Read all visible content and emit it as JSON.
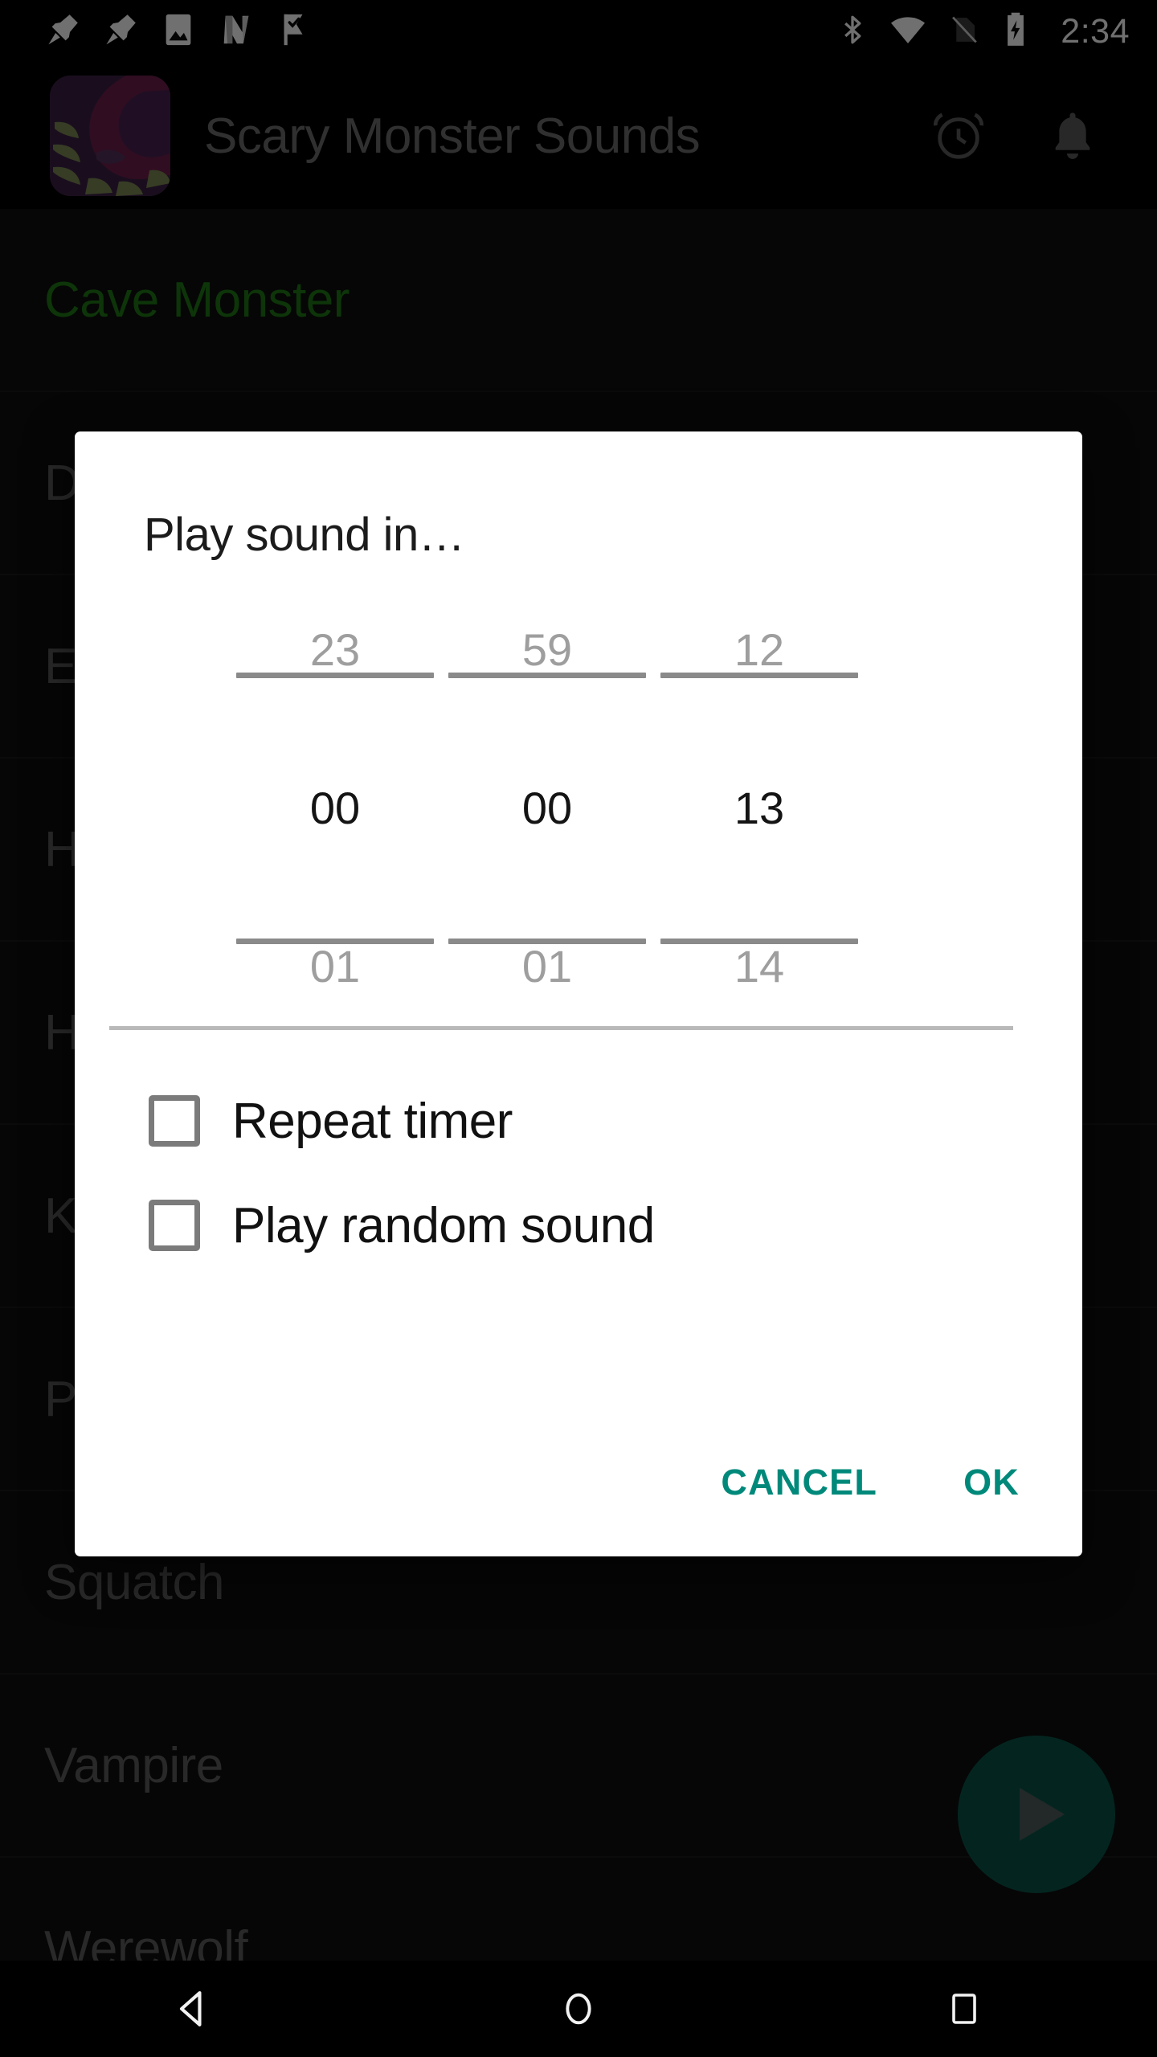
{
  "status_bar": {
    "notification_icons": [
      "pin-icon",
      "pin-icon",
      "image-icon",
      "n-app-icon",
      "checkmark-flag-icon"
    ],
    "system_icons": [
      "bluetooth-icon",
      "wifi-icon",
      "no-sim-icon",
      "battery-charging-icon"
    ],
    "clock": "2:34"
  },
  "app_bar": {
    "title": "Scary Monster Sounds",
    "icon_name": "app-logo-monster",
    "actions": [
      {
        "name": "alarm-clock-icon",
        "label": "Timer"
      },
      {
        "name": "bell-icon",
        "label": "Notification"
      }
    ]
  },
  "sound_list": {
    "items": [
      {
        "label": "Cave Monster",
        "selected": true
      },
      {
        "label": "D",
        "selected": false
      },
      {
        "label": "E",
        "selected": false
      },
      {
        "label": "H",
        "selected": false
      },
      {
        "label": "H",
        "selected": false
      },
      {
        "label": "K",
        "selected": false
      },
      {
        "label": "P",
        "selected": false
      },
      {
        "label": "Squatch",
        "selected": false
      },
      {
        "label": "Vampire",
        "selected": false
      },
      {
        "label": "Werewolf",
        "selected": false
      }
    ]
  },
  "fab": {
    "name": "play-fab",
    "icon": "play-icon",
    "color": "#0a5547"
  },
  "dialog": {
    "title": "Play sound in…",
    "pickers": [
      {
        "name": "hours",
        "prev": "23",
        "value": "00",
        "next": "01"
      },
      {
        "name": "minutes",
        "prev": "59",
        "value": "00",
        "next": "01"
      },
      {
        "name": "seconds",
        "prev": "12",
        "value": "13",
        "next": "14"
      }
    ],
    "checkboxes": [
      {
        "name": "repeat-timer",
        "label": "Repeat timer",
        "checked": false
      },
      {
        "name": "play-random-sound",
        "label": "Play random sound",
        "checked": false
      }
    ],
    "buttons": {
      "cancel": "CANCEL",
      "ok": "OK"
    },
    "accent_color": "#00897a"
  },
  "nav_bar": {
    "back": "back-icon",
    "home": "home-icon",
    "recents": "recents-icon"
  }
}
